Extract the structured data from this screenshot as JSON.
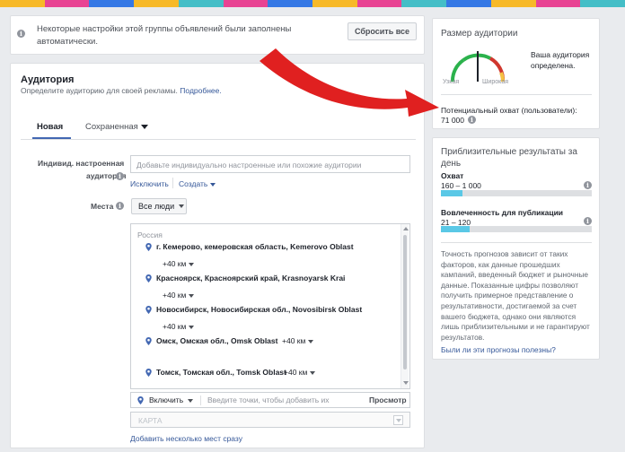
{
  "stripe_colors": [
    "#f7b928",
    "#e84393",
    "#3578e5",
    "#f7b928",
    "#44bec7",
    "#e84393",
    "#3578e5",
    "#f7b928",
    "#e84393",
    "#44bec7",
    "#3578e5",
    "#f7b928",
    "#e84393",
    "#44bec7"
  ],
  "notice": {
    "text_line1": "Некоторые настройки этой группы объявлений были заполнены",
    "text_line2": "автоматически.",
    "reset_label": "Сбросить все"
  },
  "audience": {
    "title": "Аудитория",
    "subtitle": "Определите аудиторию для своей рекламы.",
    "more_link": "Подробнее.",
    "tabs": [
      "Новая",
      "Сохраненная"
    ],
    "custom": {
      "label_line1": "Индивид. настроенная",
      "label_line2": "аудитория",
      "placeholder": "Добавьте индивидуально настроенные или похожие аудитории",
      "exclude": "Исключить",
      "create": "Создать"
    },
    "places": {
      "label": "Места",
      "dropdown": "Все люди",
      "country": "Россия",
      "locations": [
        {
          "name": "г. Кемерово, кемеровская область, Kemerovo Oblast",
          "radius": "+40 км"
        },
        {
          "name": "Красноярск, Красноярский край, Krasnoyarsk Krai",
          "radius": "+40 км"
        },
        {
          "name": "Новосибирск, Новосибирская обл., Novosibirsk Oblast",
          "radius": "+40 км"
        },
        {
          "name": "Омск, Омская обл., Omsk Oblast",
          "radius": "+40 км"
        },
        {
          "name": "Томск, Томская обл., Tomsk Oblast",
          "radius": "+40 км"
        }
      ],
      "include_label": "Включить",
      "add_placeholder": "Введите точки, чтобы добавить их",
      "browse": "Просмотр",
      "map_label": "КАРТА",
      "bulk_link": "Добавить несколько мест сразу"
    }
  },
  "audience_size": {
    "title": "Размер аудитории",
    "narrow": "Узкая",
    "wide": "Широкая",
    "defined_line1": "Ваша аудитория",
    "defined_line2": "определена.",
    "reach_label": "Потенциальный охват (пользователи):",
    "reach_value": "71 000"
  },
  "estimates": {
    "title_line1": "Приблизительные результаты за",
    "title_line2": "день",
    "reach_label": "Охват",
    "reach_range": "160 – 1 000",
    "reach_fill": 0.14,
    "engagement_label": "Вовлеченность для публикации",
    "engagement_range": "21 – 120",
    "engagement_fill": 0.19,
    "disclaimer": [
      "Точность прогнозов зависит от таких",
      "факторов, как данные прошедших",
      "кампаний, введенный бюджет и рыночные",
      "данные. Показанные цифры позволяют",
      "получить примерное представление о",
      "результативности, достигаемой за счет",
      "вашего бюджета, однако они являются",
      "лишь приблизительными и не гарантируют",
      "результатов."
    ],
    "feedback_link": "Были ли эти прогнозы полезны?"
  },
  "colors": {
    "link": "#365899",
    "bar": "#5ac8e6",
    "arrow": "#e02020",
    "gauge_green": "#2bb24c",
    "gauge_red": "#d0372e",
    "gauge_yellow": "#f5c243"
  }
}
